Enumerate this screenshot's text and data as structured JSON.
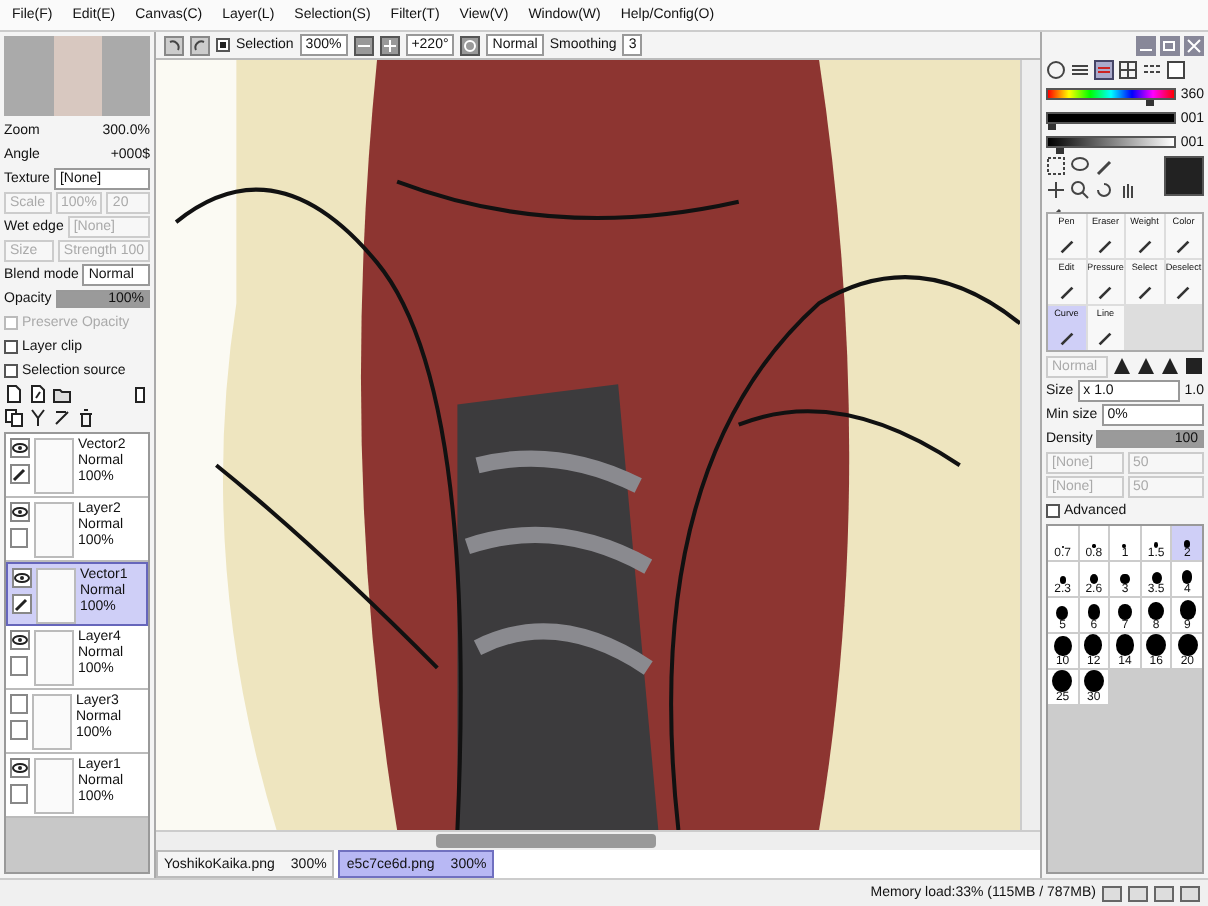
{
  "menu": [
    "File(F)",
    "Edit(E)",
    "Canvas(C)",
    "Layer(L)",
    "Selection(S)",
    "Filter(T)",
    "View(V)",
    "Window(W)",
    "Help/Config(O)"
  ],
  "toolbar": {
    "selection": {
      "label": "Selection",
      "checked": true
    },
    "zoom": "300%",
    "angle": "+220°",
    "blend": "Normal",
    "smoothing_label": "Smoothing",
    "smoothing": "3"
  },
  "navigator": {
    "zoom_label": "Zoom",
    "zoom": "300.0%",
    "angle_label": "Angle",
    "angle": "+000$"
  },
  "texture": {
    "label": "Texture",
    "value": "[None]",
    "scale": "Scale",
    "scale_value": "100%",
    "strength": "20"
  },
  "wet_edge": {
    "label": "Wet edge",
    "value": "[None]",
    "size": "Size",
    "strength": "Strength 100"
  },
  "blend_mode": {
    "label": "Blend mode",
    "value": "Normal"
  },
  "opacity": {
    "label": "Opacity",
    "value": "100%",
    "level": 1
  },
  "options": [
    {
      "label": "Preserve Opacity",
      "checked": false,
      "disabled": true
    },
    {
      "label": "Layer clip",
      "checked": false,
      "disabled": false
    },
    {
      "label": "Selection source",
      "checked": false,
      "disabled": false
    }
  ],
  "layers": [
    {
      "name": "Vector2",
      "mode": "Normal",
      "opacity": "100%",
      "kind": "vector",
      "visible": true,
      "selected": false
    },
    {
      "name": "Layer2",
      "mode": "Normal",
      "opacity": "100%",
      "kind": "raster",
      "visible": true,
      "selected": false
    },
    {
      "name": "Vector1",
      "mode": "Normal",
      "opacity": "100%",
      "kind": "vector",
      "visible": true,
      "selected": true
    },
    {
      "name": "Layer4",
      "mode": "Normal",
      "opacity": "100%",
      "kind": "raster",
      "visible": true,
      "selected": false
    },
    {
      "name": "Layer3",
      "mode": "Normal",
      "opacity": "100%",
      "kind": "raster",
      "visible": false,
      "selected": false
    },
    {
      "name": "Layer1",
      "mode": "Normal",
      "opacity": "100%",
      "kind": "raster",
      "visible": true,
      "selected": false
    }
  ],
  "color": {
    "sliders": [
      {
        "reading": "360",
        "level": 0.8
      },
      {
        "reading": "001",
        "level": 0.05
      },
      {
        "reading": "001",
        "level": 0.1
      }
    ]
  },
  "tools": [
    {
      "label": "Pen",
      "selected": false
    },
    {
      "label": "Eraser",
      "selected": false
    },
    {
      "label": "Weight",
      "selected": false
    },
    {
      "label": "Color",
      "selected": false
    },
    {
      "label": "Edit",
      "selected": false
    },
    {
      "label": "Pressure",
      "selected": false
    },
    {
      "label": "Select",
      "selected": false
    },
    {
      "label": "Deselect",
      "selected": false
    },
    {
      "label": "Curve",
      "selected": true
    },
    {
      "label": "Line",
      "selected": false
    }
  ],
  "brush": {
    "mode": "Normal",
    "size_label": "Size",
    "size_mult": "x 1.0",
    "size": "1.0",
    "min_size_label": "Min size",
    "min_size": "0%",
    "density_label": "Density",
    "density": "100",
    "density_bar": {
      "level": 1
    },
    "textures": [
      {
        "value": "[None]",
        "strength": "50"
      },
      {
        "value": "[None]",
        "strength": "50"
      }
    ],
    "advanced": {
      "label": "Advanced",
      "checked": false
    }
  },
  "brush_sizes": [
    {
      "label": "0.7",
      "selected": false
    },
    {
      "label": "0.8",
      "selected": false
    },
    {
      "label": "1",
      "selected": false
    },
    {
      "label": "1.5",
      "selected": false
    },
    {
      "label": "2",
      "selected": true
    },
    {
      "label": "2.3",
      "selected": false
    },
    {
      "label": "2.6",
      "selected": false
    },
    {
      "label": "3",
      "selected": false
    },
    {
      "label": "3.5",
      "selected": false
    },
    {
      "label": "4",
      "selected": false
    },
    {
      "label": "5",
      "selected": false
    },
    {
      "label": "6",
      "selected": false
    },
    {
      "label": "7",
      "selected": false
    },
    {
      "label": "8",
      "selected": false
    },
    {
      "label": "9",
      "selected": false
    },
    {
      "label": "10",
      "selected": false
    },
    {
      "label": "12",
      "selected": false
    },
    {
      "label": "14",
      "selected": false
    },
    {
      "label": "16",
      "selected": false
    },
    {
      "label": "20",
      "selected": false
    },
    {
      "label": "25",
      "selected": false
    },
    {
      "label": "30",
      "selected": false
    }
  ],
  "documents": [
    {
      "name": "YoshikoKaika.png",
      "zoom": "300%",
      "selected": false
    },
    {
      "name": "e5c7ce6d.png",
      "zoom": "300%",
      "selected": true
    }
  ],
  "status": {
    "memory": "Memory load:33% (115MB / 787MB)"
  }
}
